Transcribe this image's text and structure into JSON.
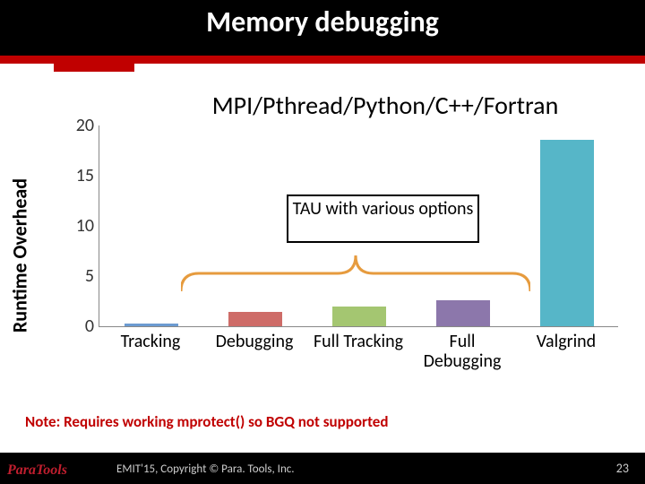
{
  "title": "Memory debugging",
  "chart_data": {
    "type": "bar",
    "title": "MPI/Pthread/Python/C++/Fortran",
    "ylabel": "Runtime Overhead",
    "xlabel": "",
    "ylim": [
      0,
      20
    ],
    "yticks": [
      0,
      5,
      10,
      15,
      20
    ],
    "categories": [
      "Tracking",
      "Debugging",
      "Full Tracking",
      "Full Debugging",
      "Valgrind"
    ],
    "values": [
      0.3,
      1.4,
      2.0,
      2.6,
      18.5
    ],
    "colors": [
      "#6C9BD1",
      "#CE6C68",
      "#A4C671",
      "#8C77AB",
      "#56B6C8"
    ],
    "annotation": "TAU with various options",
    "annotation_span": [
      0,
      3
    ]
  },
  "note": "Note: Requires working mprotect() so BGQ not supported",
  "footer": {
    "logo": "ParaTools",
    "copyright": "EMIT'15, Copyright © Para. Tools, Inc.",
    "page": "23"
  }
}
